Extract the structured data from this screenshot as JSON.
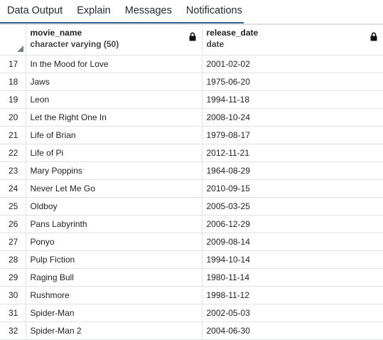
{
  "tabs": [
    {
      "label": "Data Output"
    },
    {
      "label": "Explain"
    },
    {
      "label": "Messages"
    },
    {
      "label": "Notifications"
    }
  ],
  "grid": {
    "columns": [
      {
        "name": "movie_name",
        "type": "character varying (50)",
        "icon": "lock-icon"
      },
      {
        "name": "release_date",
        "type": "date",
        "icon": "lock-icon"
      }
    ],
    "rows": [
      {
        "num": "17",
        "movie_name": "In the Mood for Love",
        "release_date": "2001-02-02"
      },
      {
        "num": "18",
        "movie_name": "Jaws",
        "release_date": "1975-06-20"
      },
      {
        "num": "19",
        "movie_name": "Leon",
        "release_date": "1994-11-18"
      },
      {
        "num": "20",
        "movie_name": "Let the Right One In",
        "release_date": "2008-10-24"
      },
      {
        "num": "21",
        "movie_name": "Life of Brian",
        "release_date": "1979-08-17"
      },
      {
        "num": "22",
        "movie_name": "Life of Pi",
        "release_date": "2012-11-21"
      },
      {
        "num": "23",
        "movie_name": "Mary Poppins",
        "release_date": "1964-08-29"
      },
      {
        "num": "24",
        "movie_name": "Never Let Me Go",
        "release_date": "2010-09-15"
      },
      {
        "num": "25",
        "movie_name": "Oldboy",
        "release_date": "2005-03-25"
      },
      {
        "num": "26",
        "movie_name": "Pans Labyrinth",
        "release_date": "2006-12-29"
      },
      {
        "num": "27",
        "movie_name": "Ponyo",
        "release_date": "2009-08-14"
      },
      {
        "num": "28",
        "movie_name": "Pulp Fiction",
        "release_date": "1994-10-14"
      },
      {
        "num": "29",
        "movie_name": "Raging Bull",
        "release_date": "1980-11-14"
      },
      {
        "num": "30",
        "movie_name": "Rushmore",
        "release_date": "1998-11-12"
      },
      {
        "num": "31",
        "movie_name": "Spider-Man",
        "release_date": "2002-05-03"
      },
      {
        "num": "32",
        "movie_name": "Spider-Man 2",
        "release_date": "2004-06-30"
      }
    ]
  },
  "colors": {
    "accent": "#326690",
    "gridline": "#dde0e6"
  }
}
